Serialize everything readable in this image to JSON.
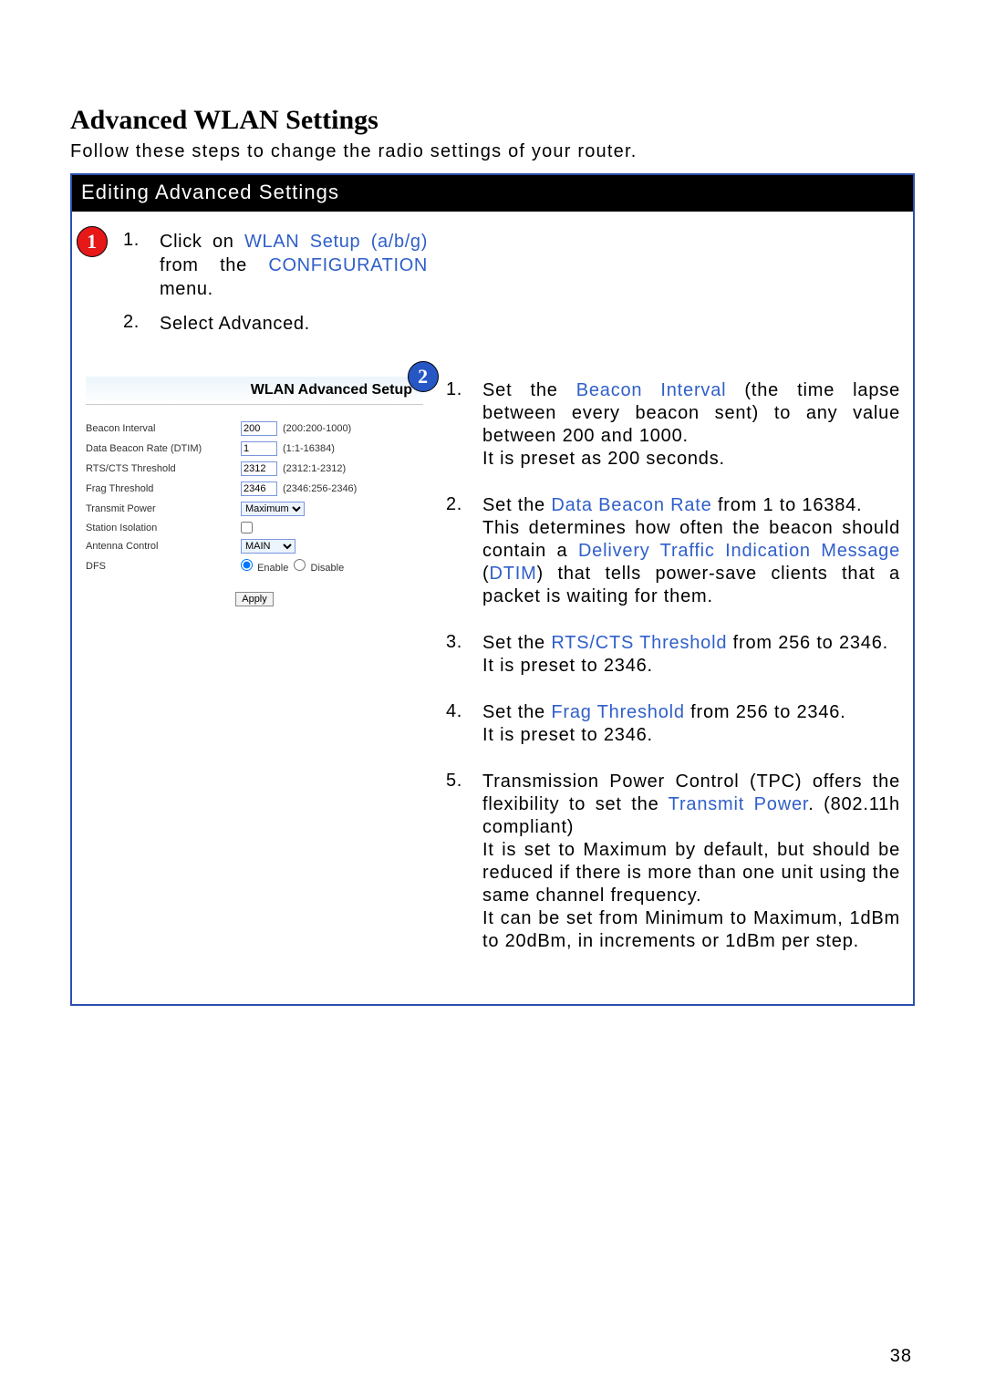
{
  "page": {
    "heading": "Advanced WLAN Settings",
    "intro": "Follow these steps to change the radio settings of your router.",
    "panel_header": "Editing Advanced Settings",
    "page_number": "38"
  },
  "badges": {
    "b1": "1",
    "b2": "2"
  },
  "left_steps": [
    {
      "num": "1.",
      "parts": [
        "Click on ",
        "WLAN Setup (a/b/g)",
        " from the ",
        "CONFIGURATION",
        " menu."
      ]
    },
    {
      "num": "2.",
      "parts": [
        "Select Advanced."
      ]
    }
  ],
  "screenshot": {
    "title": "WLAN Advanced Setup",
    "fields": {
      "beacon_interval": {
        "label": "Beacon Interval",
        "value": "200",
        "range": "(200:200-1000)"
      },
      "dtim": {
        "label": "Data Beacon Rate (DTIM)",
        "value": "1",
        "range": "(1:1-16384)"
      },
      "rts": {
        "label": "RTS/CTS Threshold",
        "value": "2312",
        "range": "(2312:1-2312)"
      },
      "frag": {
        "label": "Frag Threshold",
        "value": "2346",
        "range": "(2346:256-2346)"
      },
      "tx_power": {
        "label": "Transmit Power",
        "value": "Maximum"
      },
      "station_isolation": {
        "label": "Station Isolation"
      },
      "antenna": {
        "label": "Antenna Control",
        "value": "MAIN"
      },
      "dfs": {
        "label": "DFS",
        "enable": "Enable",
        "disable": "Disable"
      }
    },
    "apply": "Apply"
  },
  "right_steps": [
    {
      "num": "1.",
      "html": "Set the <span class='kw-blue'>Beacon Interval</span> (the time lapse between every beacon sent) to any value between 200 and 1000.<br>It is preset as 200 seconds."
    },
    {
      "num": "2.",
      "html": "Set the <span class='kw-blue'>Data Beacon Rate</span> from 1 to 16384.<br>This determines how often the beacon should contain a <span class='kw-blue'>Delivery Traffic Indication Message</span> (<span class='kw-blue'>DTIM</span>) that tells power-save clients that a packet is waiting for them."
    },
    {
      "num": "3.",
      "html": "Set the <span class='kw-blue'>RTS/CTS Threshold</span> from 256 to 2346.<br>It is preset to 2346."
    },
    {
      "num": "4.",
      "html": "Set the <span class='kw-blue'>Frag Threshold</span> from 256 to 2346.<br>It is preset to 2346."
    },
    {
      "num": "5.",
      "html": "Transmission Power Control (TPC) offers the flexibility to set the <span class='kw-blue'>Transmit Power</span>. (802.11h compliant)<br>It is set to Maximum by default, but should be reduced if there is more than one unit using the same channel frequency.<br>It can be set from Minimum to Maximum, 1dBm to 20dBm, in increments or 1dBm per step."
    }
  ]
}
